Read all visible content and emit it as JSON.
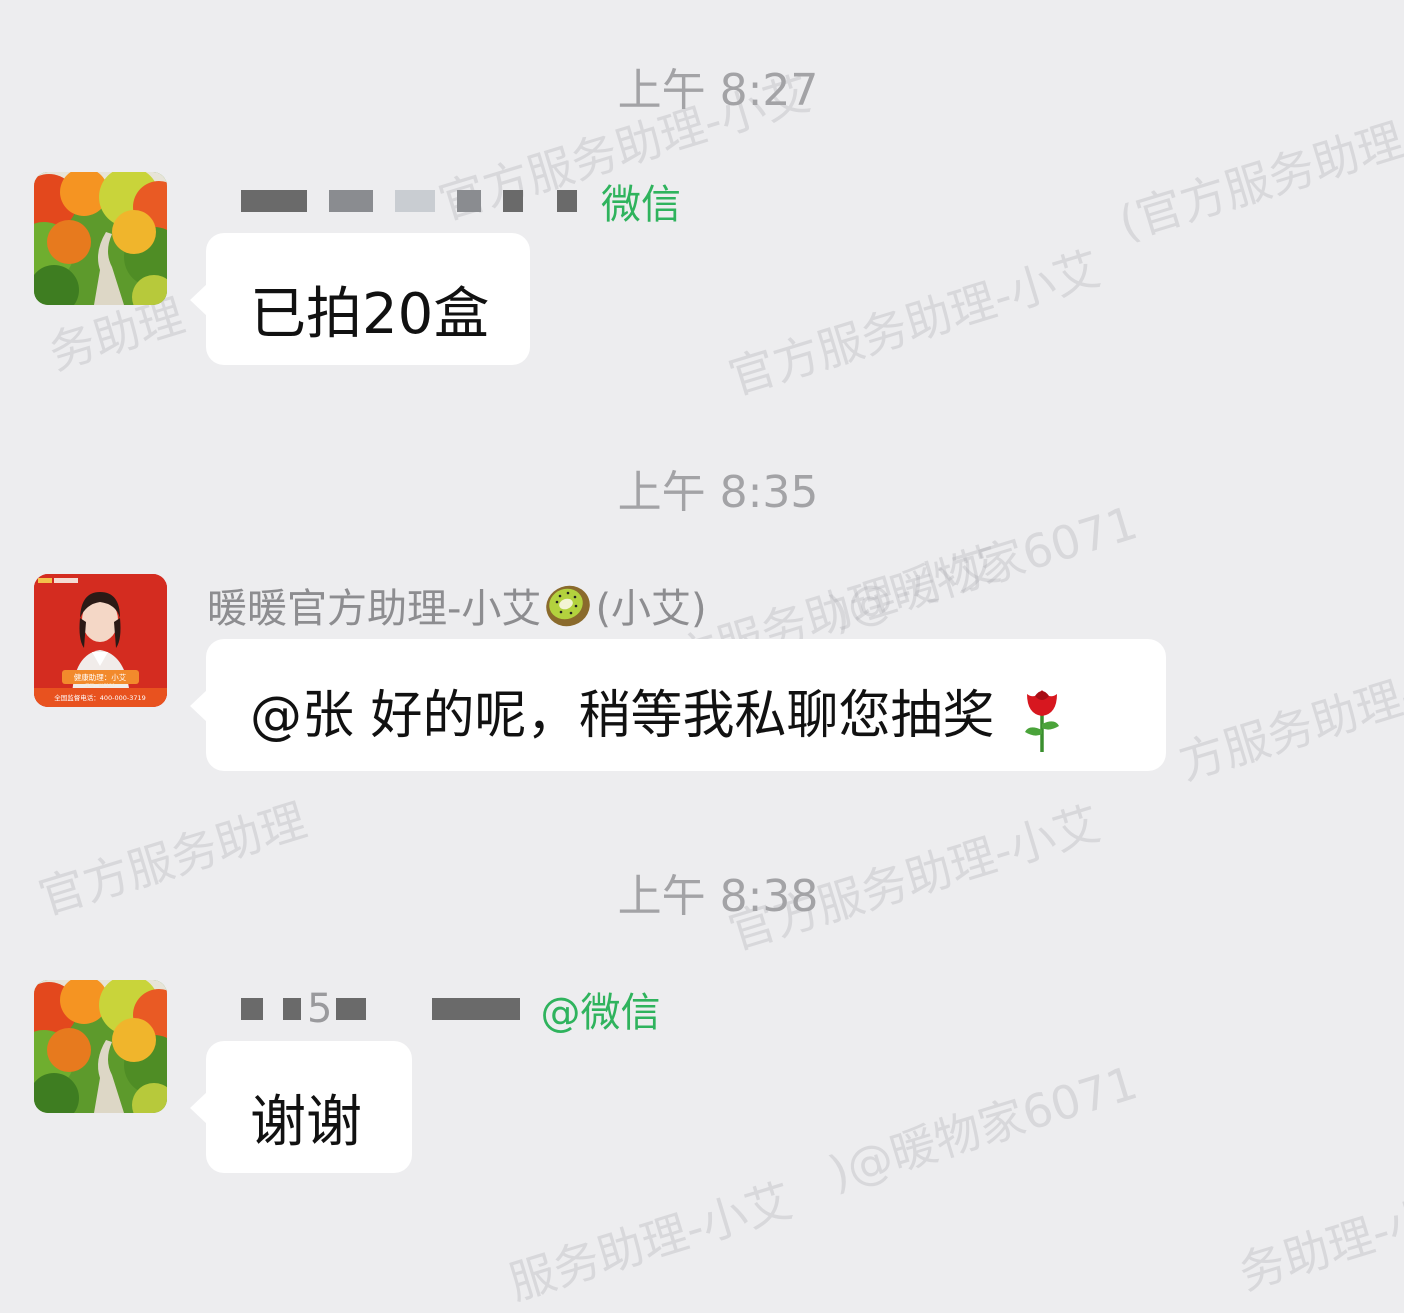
{
  "watermarks": {
    "t1": "官方服务助理-小艾",
    "t2": "官方服务助理-小艾",
    "t3": "(官方服务助理-小艾",
    "t4": "务助理",
    "t5": "官方服务助理-小艾",
    "t6": ")@暖物家6071",
    "t7": "方服务助理-小",
    "t8": "官方服务助理",
    "t9": "官方服务助理-小艾",
    "t10": ")@暖物家6071",
    "t11": "服务助理-小艾",
    "t12": "务助理-小"
  },
  "messages": [
    {
      "time": "上午 8:27",
      "sender_suffix": "微信",
      "text": "已拍20盒"
    },
    {
      "time": "上午 8:35",
      "sender_name": "暖暖官方助理-小艾",
      "sender_after": "(小艾)",
      "text": "@张 好的呢，稍等我私聊您抽奖",
      "emoji_icon": "rose-icon",
      "avatar": {
        "badge_line1": "健康助理：小艾",
        "badge_line2": "工号：WC120",
        "phone": "全国监督电话：400-000-3719"
      }
    },
    {
      "time": "上午 8:38",
      "sender_fragment": "5",
      "sender_suffix": "@微信",
      "text": "谢谢"
    }
  ],
  "colors": {
    "background": "#ededef",
    "bubble": "#ffffff",
    "wechat_green": "#2fb35d",
    "timestamp": "#a3a3a6"
  }
}
